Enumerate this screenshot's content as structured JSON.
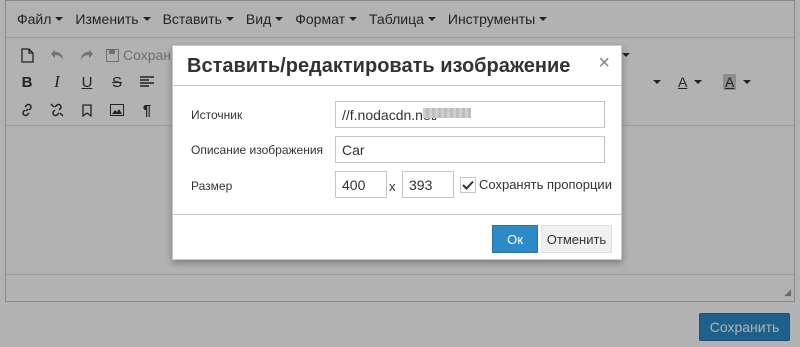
{
  "menubar": {
    "items": [
      {
        "label": "Файл"
      },
      {
        "label": "Изменить"
      },
      {
        "label": "Вставить"
      },
      {
        "label": "Вид"
      },
      {
        "label": "Формат"
      },
      {
        "label": "Таблица"
      },
      {
        "label": "Инструменты"
      }
    ]
  },
  "toolbar": {
    "save_label": "Сохран"
  },
  "dialog": {
    "title": "Вставить/редактировать изображение",
    "close_glyph": "×",
    "source_label": "Источник",
    "source_value": "//f.nodacdn.net/",
    "description_label": "Описание изображения",
    "description_value": "Car",
    "size_label": "Размер",
    "width_value": "400",
    "height_value": "393",
    "size_separator": "x",
    "constrain_label": "Сохранять пропорции",
    "constrain_checked": true,
    "ok_label": "Ок",
    "cancel_label": "Отменить"
  },
  "page": {
    "save_button_label": "Сохранить"
  },
  "colors": {
    "primary_button": "#2d8ac7",
    "overlay": "rgba(0,0,0,0.3)"
  }
}
